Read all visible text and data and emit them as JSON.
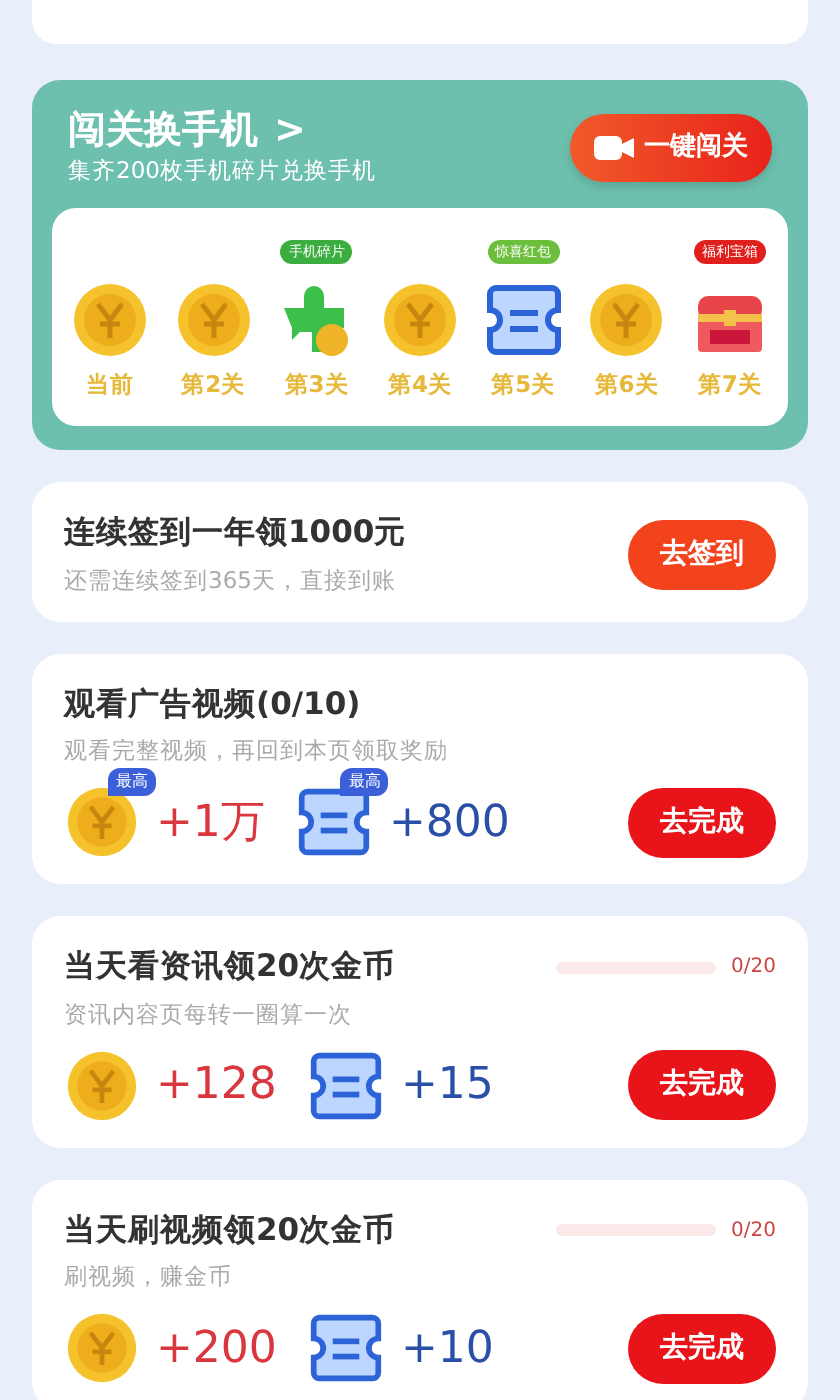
{
  "challenge": {
    "title": "闯关换手机",
    "arrow": ">",
    "subtitle": "集齐200枚手机碎片兑换手机",
    "button": {
      "label": "一键闯关"
    },
    "levels": [
      {
        "label": "当前",
        "kind": "coin"
      },
      {
        "label": "第2关",
        "kind": "coin"
      },
      {
        "label": "第3关",
        "kind": "puzzle",
        "tag": "手机碎片",
        "color": "#3cae3f"
      },
      {
        "label": "第4关",
        "kind": "coin"
      },
      {
        "label": "第5关",
        "kind": "ticket",
        "tag": "惊喜红包",
        "color": "#6cbf3c"
      },
      {
        "label": "第6关",
        "kind": "coin"
      },
      {
        "label": "第7关",
        "kind": "chest",
        "tag": "福利宝箱",
        "color": "#e0201c"
      }
    ]
  },
  "tasks": [
    {
      "title": "连续签到一年领1000元",
      "subtitle": "还需连续签到365天，直接到账",
      "button": {
        "label": "去签到",
        "kind": "sign"
      }
    },
    {
      "title": "观看广告视频(0/10)",
      "subtitle": "观看完整视频，再回到本页领取奖励",
      "rewards": [
        {
          "kind": "coin",
          "amount": "+1万",
          "badge": "最高"
        },
        {
          "kind": "ticket",
          "amount": "+800",
          "badge": "最高"
        }
      ],
      "button": {
        "label": "去完成",
        "kind": "complete"
      }
    },
    {
      "title": "当天看资讯领20次金币",
      "subtitle": "资讯内容页每转一圈算一次",
      "progress": {
        "level": 0,
        "reading": "0/20"
      },
      "rewards": [
        {
          "kind": "coin",
          "amount": "+128"
        },
        {
          "kind": "ticket",
          "amount": "+15"
        }
      ],
      "button": {
        "label": "去完成",
        "kind": "complete"
      }
    },
    {
      "title": "当天刷视频领20次金币",
      "subtitle": "刷视频，赚金币",
      "progress": {
        "level": 0,
        "reading": "0/20"
      },
      "rewards": [
        {
          "kind": "coin",
          "amount": "+200"
        },
        {
          "kind": "ticket",
          "amount": "+10"
        }
      ],
      "button": {
        "label": "去完成",
        "kind": "complete"
      }
    }
  ]
}
